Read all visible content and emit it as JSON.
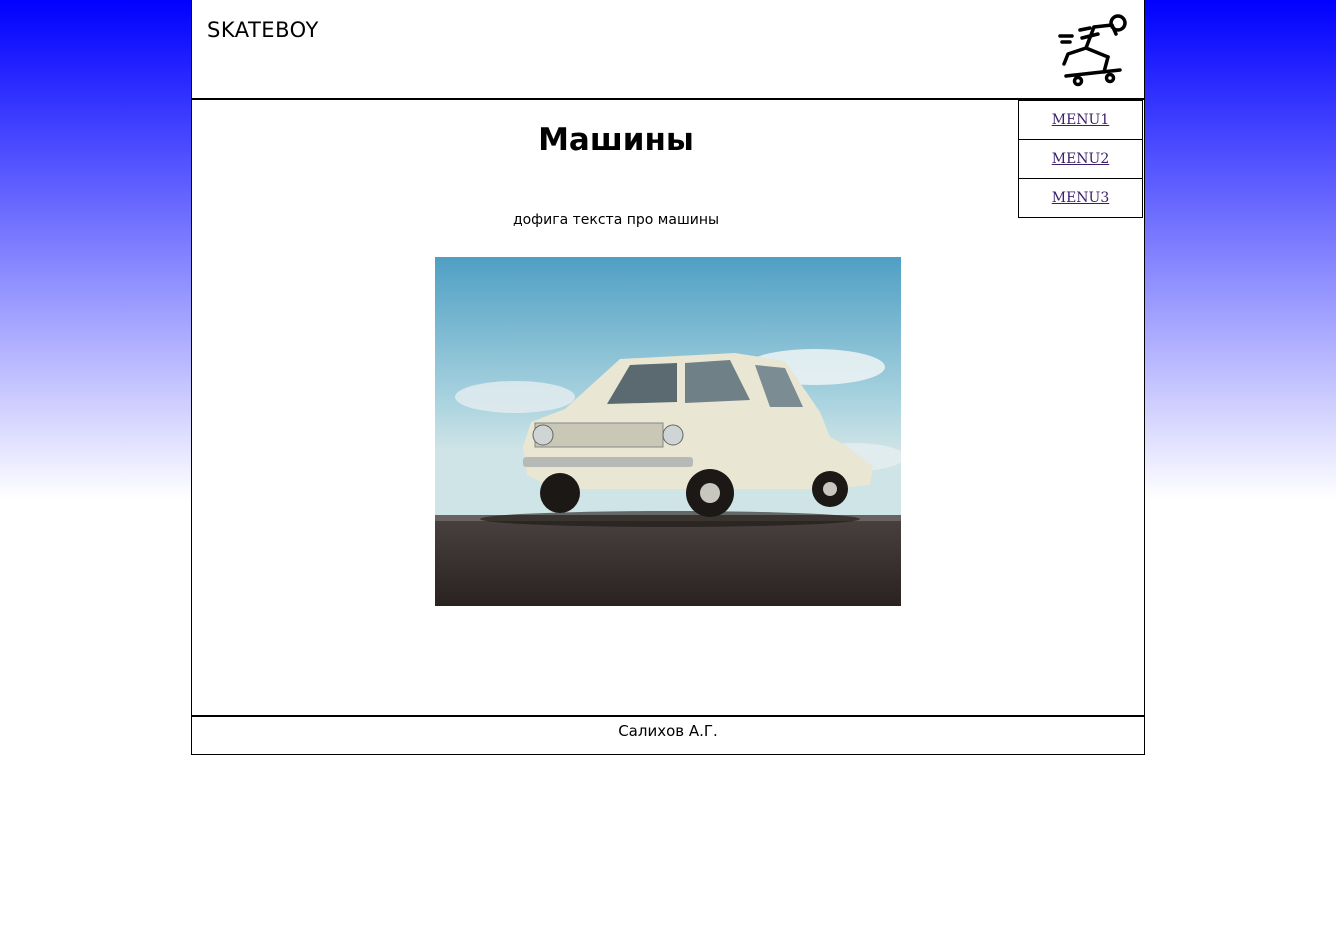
{
  "header": {
    "brand": "SKATEBOY",
    "logo_icon": "skateboarder-icon"
  },
  "menu": {
    "items": [
      {
        "label": "MENU1"
      },
      {
        "label": "MENU2"
      },
      {
        "label": "MENU3"
      }
    ]
  },
  "main": {
    "title": "Машины",
    "text": "дофига текста про машины",
    "image": "white-sedan-photo"
  },
  "footer": {
    "author": "Салихов А.Г."
  },
  "colors": {
    "gradient_top": "#0000ff",
    "gradient_bottom": "#ffffff",
    "link": "#3a1e6b"
  }
}
